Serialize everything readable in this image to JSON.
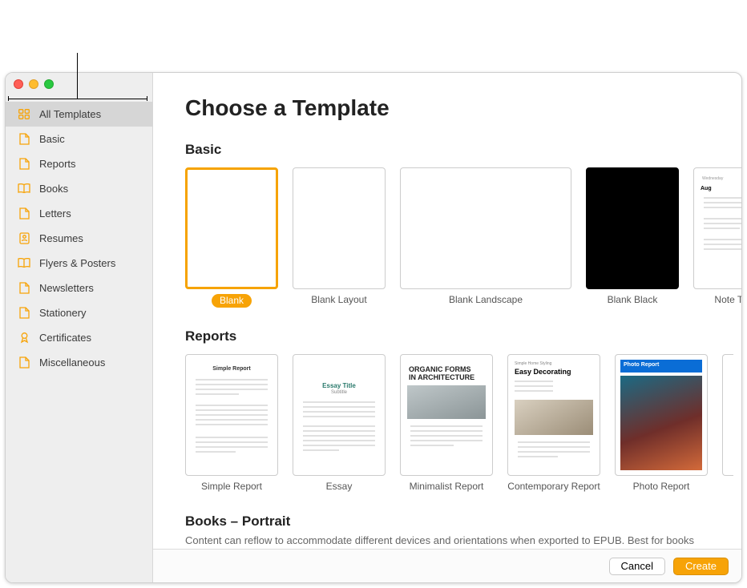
{
  "title": "Choose a Template",
  "sidebar": {
    "items": [
      {
        "label": "All Templates",
        "icon": "grid",
        "selected": true
      },
      {
        "label": "Basic",
        "icon": "page",
        "selected": false
      },
      {
        "label": "Reports",
        "icon": "page",
        "selected": false
      },
      {
        "label": "Books",
        "icon": "book",
        "selected": false
      },
      {
        "label": "Letters",
        "icon": "page",
        "selected": false
      },
      {
        "label": "Resumes",
        "icon": "profile",
        "selected": false
      },
      {
        "label": "Flyers & Posters",
        "icon": "book",
        "selected": false
      },
      {
        "label": "Newsletters",
        "icon": "page",
        "selected": false
      },
      {
        "label": "Stationery",
        "icon": "page",
        "selected": false
      },
      {
        "label": "Certificates",
        "icon": "ribbon",
        "selected": false
      },
      {
        "label": "Miscellaneous",
        "icon": "page",
        "selected": false
      }
    ]
  },
  "sections": [
    {
      "title": "Basic",
      "templates": [
        {
          "name": "Blank",
          "kind": "blank",
          "selected": true
        },
        {
          "name": "Blank Layout",
          "kind": "blank",
          "selected": false
        },
        {
          "name": "Blank Landscape",
          "kind": "blank-wide",
          "selected": false
        },
        {
          "name": "Blank Black",
          "kind": "black",
          "selected": false
        },
        {
          "name": "Note Taking",
          "kind": "note",
          "selected": false
        }
      ]
    },
    {
      "title": "Reports",
      "templates": [
        {
          "name": "Simple Report",
          "kind": "simple-report",
          "selected": false
        },
        {
          "name": "Essay",
          "kind": "essay",
          "selected": false
        },
        {
          "name": "Minimalist Report",
          "kind": "minimalist",
          "selected": false
        },
        {
          "name": "Contemporary Report",
          "kind": "contemporary",
          "selected": false
        },
        {
          "name": "Photo Report",
          "kind": "photo-report",
          "selected": false
        }
      ]
    },
    {
      "title": "Books – Portrait",
      "subtitle": "Content can reflow to accommodate different devices and orientations when exported to EPUB. Best for books",
      "templates": []
    }
  ],
  "thumb_text": {
    "simple_report": "Simple Report",
    "essay_title": "Essay Title",
    "essay_subtitle": "Subtitle",
    "minimalist_l1": "ORGANIC FORMS",
    "minimalist_l2": "IN ARCHITECTURE",
    "contemporary_l1": "Simple Home Styling",
    "contemporary_l2": "Easy Decorating",
    "photo_report": "Photo Report",
    "note_taking": "Aug"
  },
  "footer": {
    "cancel": "Cancel",
    "create": "Create"
  },
  "colors": {
    "accent": "#f7a307",
    "selection_border": "#f6a300"
  }
}
